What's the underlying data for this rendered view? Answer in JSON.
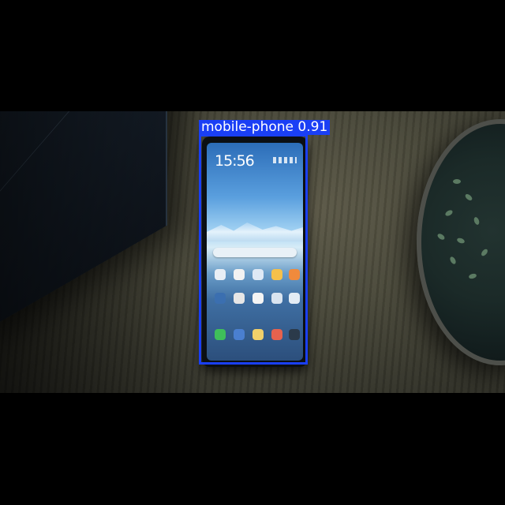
{
  "detection": {
    "class_label": "mobile-phone",
    "confidence": "0.91",
    "box_color": "#1a3ff5"
  },
  "scene": {
    "background_color": "#000000",
    "surface": "wooden-table",
    "objects": [
      "laptop",
      "mobile-phone",
      "plant-pot"
    ]
  },
  "phone_screen": {
    "clock_text": "15:56"
  }
}
